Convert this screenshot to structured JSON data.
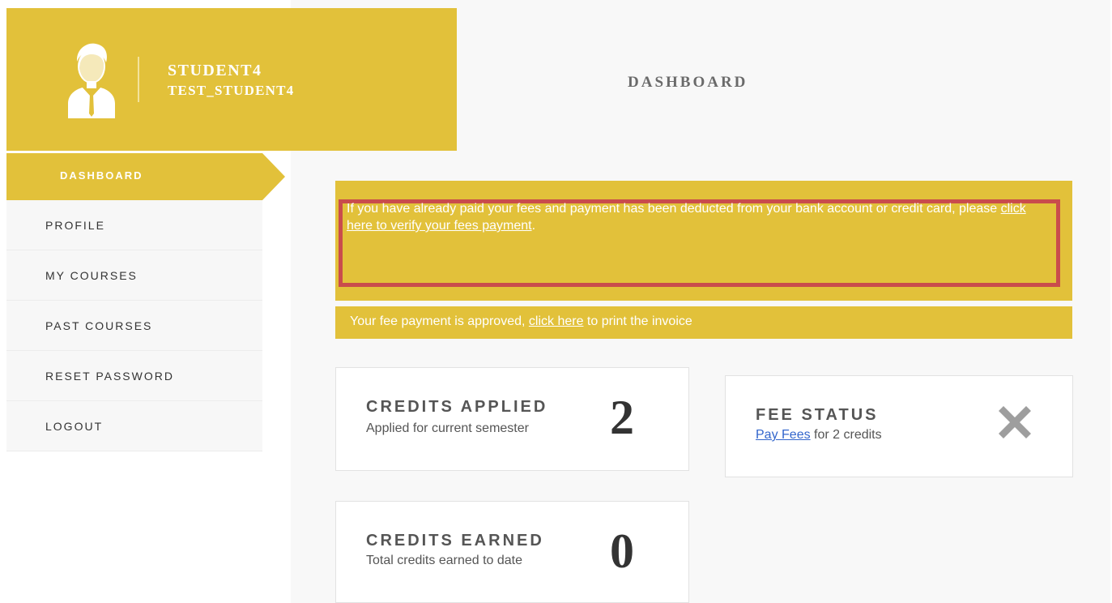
{
  "profile": {
    "name": "STUDENT4",
    "username": "TEST_STUDENT4",
    "avatar_icon": "user-avatar-icon"
  },
  "header": {
    "title": "DASHBOARD"
  },
  "sidebar": {
    "items": [
      {
        "label": "DASHBOARD",
        "active": true
      },
      {
        "label": "PROFILE"
      },
      {
        "label": "MY COURSES"
      },
      {
        "label": "PAST COURSES"
      },
      {
        "label": "RESET PASSWORD"
      },
      {
        "label": "LOGOUT"
      }
    ]
  },
  "alerts": {
    "verify_prefix": "If you have already paid your fees and payment has been deducted from your bank account or credit card, please ",
    "verify_link": "click here to verify your fees payment",
    "verify_suffix": ".",
    "approved_prefix": "Your fee payment is approved, ",
    "approved_link": "click here",
    "approved_suffix": " to print the invoice"
  },
  "cards": {
    "credits_applied": {
      "title": "CREDITS APPLIED",
      "subtitle": "Applied for current semester",
      "value": "2"
    },
    "credits_earned": {
      "title": "CREDITS EARNED",
      "subtitle": "Total credits earned to date",
      "value": "0"
    },
    "fee_status": {
      "title": "FEE STATUS",
      "link": "Pay Fees",
      "suffix": " for 2 credits",
      "icon": "close-x-icon"
    }
  },
  "colors": {
    "accent": "#e2c13a",
    "highlight_border": "#c94c4c",
    "link": "#3366cc"
  }
}
